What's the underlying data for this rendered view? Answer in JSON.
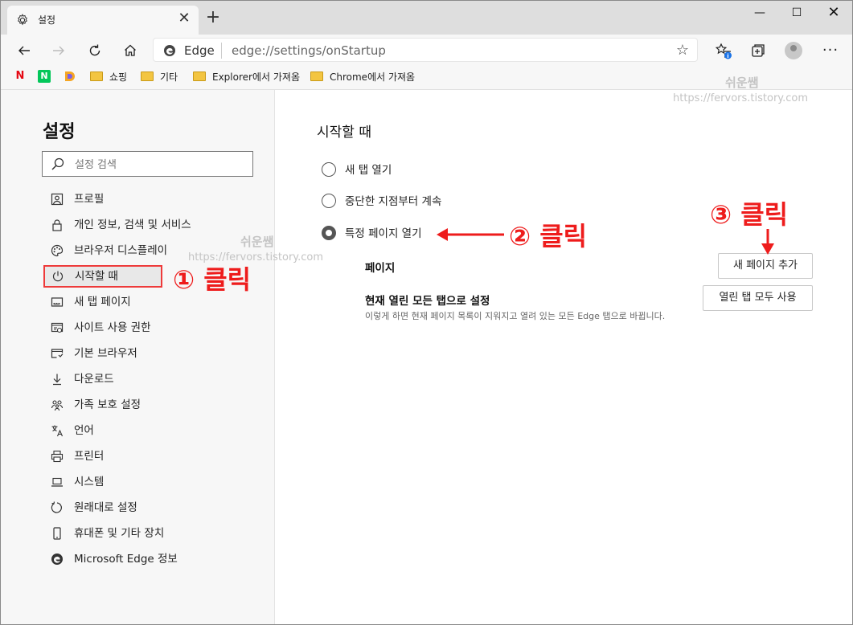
{
  "browser": {
    "tab_title": "설정",
    "tab_close": "✕",
    "new_tab": "+",
    "window_controls": {
      "minimize": "—",
      "maximize": "☐",
      "close": "✕"
    }
  },
  "address_bar": {
    "site_name": "Edge",
    "url": "edge://settings/onStartup",
    "favorite_star": "☆"
  },
  "bookmarks": [
    {
      "label": "쇼핑"
    },
    {
      "label": "기타"
    },
    {
      "label": "Explorer에서 가져옴"
    },
    {
      "label": "Chrome에서 가져옴"
    }
  ],
  "sidebar": {
    "title": "설정",
    "search_placeholder": "설정 검색",
    "items": [
      {
        "label": "프로필",
        "icon": "profile-icon"
      },
      {
        "label": "개인 정보, 검색 및 서비스",
        "icon": "lock-icon"
      },
      {
        "label": "브라우저 디스플레이",
        "icon": "palette-icon"
      },
      {
        "label": "시작할 때",
        "icon": "power-icon",
        "selected": true
      },
      {
        "label": "새 탭 페이지",
        "icon": "new-tab-icon"
      },
      {
        "label": "사이트 사용 권한",
        "icon": "site-permissions-icon"
      },
      {
        "label": "기본 브라우저",
        "icon": "default-browser-icon"
      },
      {
        "label": "다운로드",
        "icon": "download-icon"
      },
      {
        "label": "가족 보호 설정",
        "icon": "family-icon"
      },
      {
        "label": "언어",
        "icon": "language-icon"
      },
      {
        "label": "프린터",
        "icon": "printer-icon"
      },
      {
        "label": "시스템",
        "icon": "system-icon"
      },
      {
        "label": "원래대로 설정",
        "icon": "reset-icon"
      },
      {
        "label": "휴대폰 및 기타 장치",
        "icon": "phone-icon"
      },
      {
        "label": "Microsoft Edge 정보",
        "icon": "edge-icon"
      }
    ]
  },
  "main": {
    "section_title": "시작할 때",
    "options": [
      {
        "label": "새 탭 열기",
        "checked": false
      },
      {
        "label": "중단한 지점부터 계속",
        "checked": false
      },
      {
        "label": "특정 페이지 열기",
        "checked": true
      }
    ],
    "pages_label": "페이지",
    "add_page_button": "새 페이지 추가",
    "use_open_tabs_label": "현재 열린 모든 탭으로 설정",
    "use_open_tabs_desc": "이렇게 하면 현재 페이지 목록이 지워지고 열려 있는 모든 Edge 탭으로 바뀝니다.",
    "use_all_open_tabs_button": "열린 탭 모두 사용"
  },
  "watermarks": {
    "name": "쉬운쌤",
    "url": "https://fervors.tistory.com"
  },
  "annotations": {
    "step1": "① 클릭",
    "step2": "② 클릭",
    "step3": "③ 클릭",
    "color": "#ee1c1c"
  }
}
